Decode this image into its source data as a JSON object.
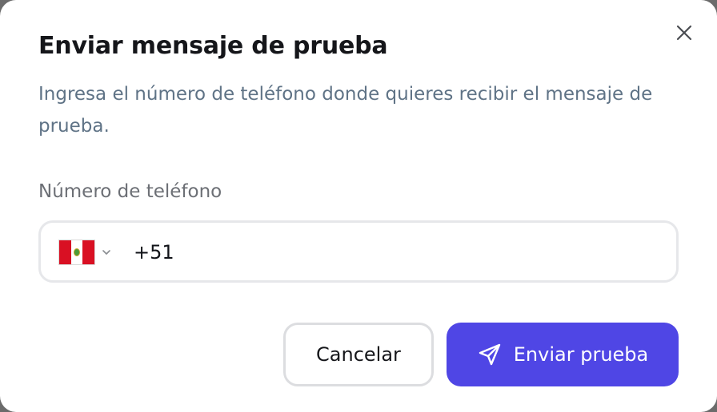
{
  "dialog": {
    "title": "Enviar mensaje de prueba",
    "description": "Ingresa el número de teléfono donde quieres recibir el mensaje de prueba.",
    "close_icon": "close-icon"
  },
  "phone": {
    "label": "Número de teléfono",
    "country_flag": "peru-flag-icon",
    "value": "+51"
  },
  "actions": {
    "cancel_label": "Cancelar",
    "send_label": "Enviar prueba",
    "send_icon": "paper-plane-icon"
  },
  "colors": {
    "primary": "#4f46e5",
    "title": "#15161a",
    "description": "#5f7386",
    "label": "#6c6f75",
    "border": "#e6e7ea"
  }
}
